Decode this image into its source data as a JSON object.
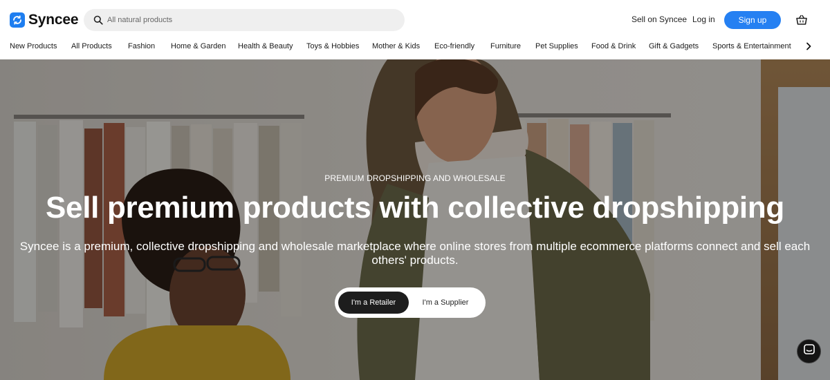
{
  "brand": {
    "name": "Syncee",
    "logo_icon": "sync-icon",
    "accent": "#1e7ef0"
  },
  "search": {
    "placeholder": "All natural products",
    "icon": "search-icon"
  },
  "header": {
    "sell_link": "Sell on Syncee",
    "login_link": "Log in",
    "signup_button": "Sign up",
    "cart_icon": "basket-icon",
    "signup_color": "#2580f2"
  },
  "categories": [
    "New Products",
    "All Products",
    "Fashion",
    "Home & Garden",
    "Health & Beauty",
    "Toys & Hobbies",
    "Mother & Kids",
    "Eco-friendly",
    "Furniture",
    "Pet Supplies",
    "Food & Drink",
    "Gift & Gadgets",
    "Sports & Entertainment"
  ],
  "hero": {
    "eyebrow": "PREMIUM DROPSHIPPING AND WHOLESALE",
    "headline": "Sell premium products with collective dropshipping",
    "subtext": "Syncee is a premium, collective dropshipping and wholesale marketplace where online stores from multiple ecommerce platforms connect and sell each others' products.",
    "retailer_button": "I'm a Retailer",
    "supplier_button": "I'm a Supplier",
    "selected_role": "I'm a Retailer"
  },
  "chat": {
    "icon": "chat-icon"
  }
}
